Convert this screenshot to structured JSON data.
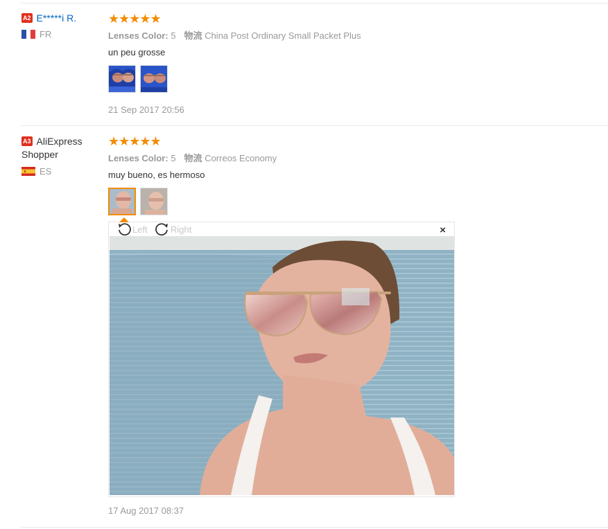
{
  "reviews": [
    {
      "level": "A2",
      "user_name": "E*****i R.",
      "country": "FR",
      "stars": "★★★★★",
      "attr_label": "Lenses Color:",
      "attr_value": "5",
      "shipping_label": "物流",
      "shipping_value": "China Post Ordinary Small Packet Plus",
      "text": "un peu grosse",
      "date": "21 Sep 2017 20:56"
    },
    {
      "level": "A3",
      "user_name": "AliExpress Shopper",
      "country": "ES",
      "stars": "★★★★★",
      "attr_label": "Lenses Color:",
      "attr_value": "5",
      "shipping_label": "物流",
      "shipping_value": "Correos Economy",
      "text": "muy bueno, es hermoso",
      "date": "17 Aug 2017 08:37"
    }
  ],
  "viewer": {
    "rotate_left": "Left",
    "rotate_right": "Right",
    "close": "×"
  },
  "colors": {
    "star": "#f38b00",
    "level_badge": "#e0301e",
    "link": "#0066c0",
    "muted": "#999999"
  }
}
